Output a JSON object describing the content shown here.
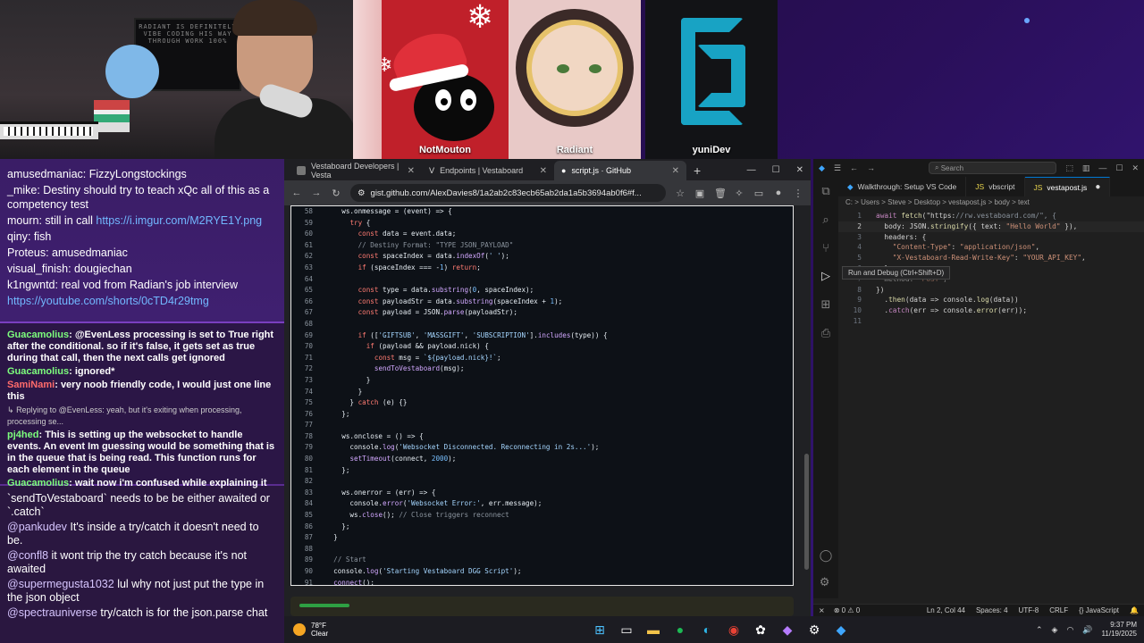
{
  "guests": [
    {
      "name": "NotMouton"
    },
    {
      "name": "Radiant"
    },
    {
      "name": "yuniDev"
    }
  ],
  "webcam": {
    "monitor_text": "RADIANT IS DEFINITELY VIBE CODING HIS WAY THROUGH WORK 100%"
  },
  "chat": {
    "top": [
      {
        "user": "amusedmaniac",
        "text": "FizzyLongstockings"
      },
      {
        "user": "_mike",
        "text": "Destiny should try to teach xQc all of this as a competency test"
      },
      {
        "user": "mourn",
        "text": "still in call",
        "link": "https://i.imgur.com/M2RYE1Y.png"
      },
      {
        "user": "qiny",
        "text": "fish"
      },
      {
        "user": "Proteus",
        "text": "amusedmaniac"
      },
      {
        "user": "visual_finish",
        "text": "dougiechan"
      },
      {
        "user": "k1ngwntd",
        "text": "real vod from Radian's job interview"
      },
      {
        "user": "",
        "text": "",
        "link": "https://youtube.com/shorts/0cTD4r29tmg"
      }
    ],
    "middle": [
      {
        "user": "Guacamolius",
        "text": "@EvenLess processing is set to True right after the conditional. so if it's false, it gets set as true during that call, then the next calls get ignored"
      },
      {
        "user": "Guacamolius",
        "text": "ignored*"
      },
      {
        "user": "SamiNami",
        "text": "very noob friendly code, I would just one line this"
      },
      {
        "user": "",
        "reply": "Replying to @EvenLess: yeah, but it's exiting when processing, processing se..."
      },
      {
        "user": "pj4hed",
        "text": "This is setting up the websocket to handle events. An event Im guessing would be something that is in the queue that is being read. This function runs for each element in the queue"
      },
      {
        "user": "Guacamolius",
        "text": "wait now i'm confused while explaining it"
      }
    ],
    "bottom": [
      {
        "user": "",
        "text": "`sendToVestaboard` needs to be be either awaited or `.catch`"
      },
      {
        "user": "@pankudev",
        "text": "It's inside a try/catch it doesn't need to be."
      },
      {
        "user": "@confl8",
        "text": "it wont trip the try catch because it's not awaited"
      },
      {
        "user": "@supermegusta1032",
        "text": "lul why not just put the type in the json object"
      },
      {
        "user": "@spectrauniverse",
        "text": "try/catch is for the json.parse chat"
      }
    ]
  },
  "browser": {
    "tabs": [
      {
        "title": "Vestaboard Developers | Vesta"
      },
      {
        "title": "Endpoints | Vestaboard"
      },
      {
        "title": "script.js · GitHub",
        "active": true
      }
    ],
    "new_tab": "+",
    "url": "gist.github.com/AlexDavies8/1a2ab2c83ecb65ab2da1a5b3694ab0f6#f...",
    "first_line": 58,
    "lines": [
      "    ws.onmessage = (event) => {",
      "      try {",
      "        const data = event.data;",
      "        // Destiny Format: \"TYPE JSON_PAYLOAD\"",
      "        const spaceIndex = data.indexOf(' ');",
      "        if (spaceIndex === -1) return;",
      "",
      "        const type = data.substring(0, spaceIndex);",
      "        const payloadStr = data.substring(spaceIndex + 1);",
      "        const payload = JSON.parse(payloadStr);",
      "",
      "        if (['GIFTSUB', 'MASSGIFT', 'SUBSCRIPTION'].includes(type)) {",
      "          if (payload && payload.nick) {",
      "            const msg = `${payload.nick}!`;",
      "            sendToVestaboard(msg);",
      "          }",
      "        }",
      "      } catch (e) {}",
      "    };",
      "",
      "    ws.onclose = () => {",
      "      console.log('Websocket Disconnected. Reconnecting in 2s...');",
      "      setTimeout(connect, 2000);",
      "    };",
      "",
      "    ws.onerror = (err) => {",
      "      console.error('Websocket Error:', err.message);",
      "      ws.close(); // Close triggers reconnect",
      "    };",
      "  }",
      "",
      "  // Start",
      "  console.log('Starting Vestaboard DGG Script');",
      "  connect();"
    ]
  },
  "vscode": {
    "search": "Search",
    "tabs": [
      {
        "title": "Walkthrough: Setup VS Code"
      },
      {
        "title": "vbscript"
      },
      {
        "title": "vestapost.js",
        "active": true,
        "dirty": "●"
      }
    ],
    "breadcrumbs": "C: > Users > Steve > Desktop > vestapost.js > body > text",
    "tooltip": "Run and Debug (Ctrl+Shift+D)",
    "lines": [
      "await fetch(\"https://rw.vestaboard.com/\", {",
      "  body: JSON.stringify({ text: \"Hello World\" }),",
      "  headers: {",
      "    \"Content-Type\": \"application/json\",",
      "    \"X-Vestaboard-Read-Write-Key\": \"YOUR_API_KEY\",",
      "  },",
      "  method: \"POST\",",
      "})",
      "  .then(data => console.log(data))",
      "  .catch(err => console.error(err));",
      ""
    ],
    "status": {
      "errors": "⊗ 0 ⚠ 0",
      "position": "Ln 2, Col 44",
      "spaces": "Spaces: 4",
      "encoding": "UTF-8",
      "eol": "CRLF",
      "lang": "{} JavaScript"
    }
  },
  "taskbar": {
    "temp": "78°F",
    "condition": "Clear",
    "time": "9:37 PM",
    "date": "11/19/2025"
  }
}
